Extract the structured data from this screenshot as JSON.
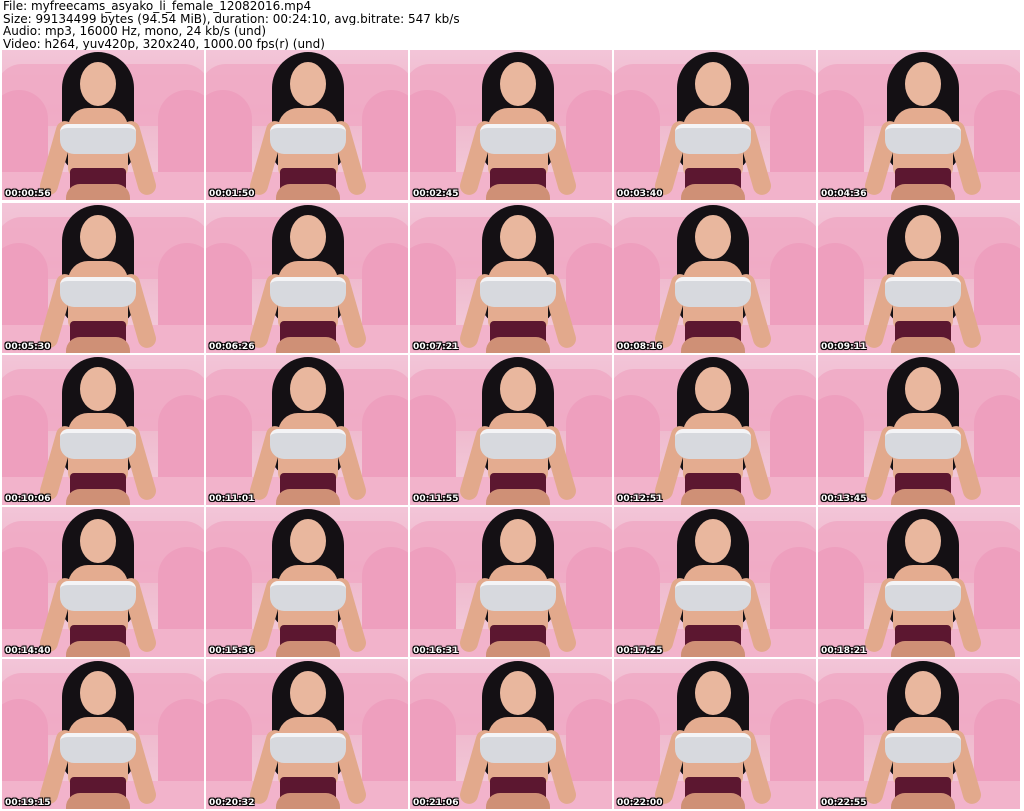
{
  "header": {
    "file": "File: myfreecams_asyako_li_female_12082016.mp4",
    "size": "Size: 99134499 bytes (94.54 MiB), duration: 00:24:10, avg.bitrate: 547 kb/s",
    "audio": "Audio: mp3, 16000 Hz, mono, 24 kb/s (und)",
    "video": "Video: h264, yuv420p, 320x240, 1000.00 fps(r) (und)"
  },
  "thumbnails": [
    {
      "timestamp": "00:00:56"
    },
    {
      "timestamp": "00:01:50"
    },
    {
      "timestamp": "00:02:45"
    },
    {
      "timestamp": "00:03:40"
    },
    {
      "timestamp": "00:04:36"
    },
    {
      "timestamp": "00:05:30"
    },
    {
      "timestamp": "00:06:26"
    },
    {
      "timestamp": "00:07:21"
    },
    {
      "timestamp": "00:08:16"
    },
    {
      "timestamp": "00:09:11"
    },
    {
      "timestamp": "00:10:06"
    },
    {
      "timestamp": "00:11:01"
    },
    {
      "timestamp": "00:11:55"
    },
    {
      "timestamp": "00:12:51"
    },
    {
      "timestamp": "00:13:45"
    },
    {
      "timestamp": "00:14:40"
    },
    {
      "timestamp": "00:15:36"
    },
    {
      "timestamp": "00:16:31"
    },
    {
      "timestamp": "00:17:25"
    },
    {
      "timestamp": "00:18:21"
    },
    {
      "timestamp": "00:19:15"
    },
    {
      "timestamp": "00:20:32"
    },
    {
      "timestamp": "00:21:06"
    },
    {
      "timestamp": "00:22:00"
    },
    {
      "timestamp": "00:22:55"
    }
  ]
}
